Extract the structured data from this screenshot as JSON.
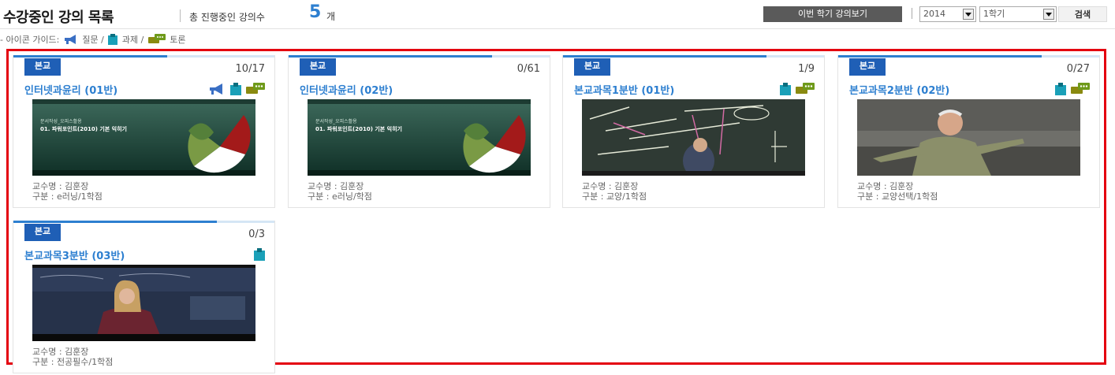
{
  "header": {
    "title": "수강중인 강의 목록",
    "subtitle": "총 진행중인 강의수",
    "count": "5",
    "count_unit": "개",
    "semester_button": "이번 학기 강의보기",
    "year_select": "2014",
    "term_select": "1학기",
    "search_button": "검색"
  },
  "guide": {
    "prefix": "- 아이콘 가이드:",
    "question": "질문 /",
    "assignment": "과제 /",
    "discussion": "토론"
  },
  "colors": {
    "accent": "#2d7fd0",
    "badge": "#1f5fb6",
    "highlight_border": "#e4000f",
    "icon_question": "#3a6fc4",
    "icon_assignment": "#1aa0b8",
    "icon_discussion": "#8a8a10"
  },
  "courses": [
    {
      "badge": "본교",
      "progress_text": "10/17",
      "progress": 0.59,
      "title": "인터넷과윤리 (01반)",
      "icons": [
        "megaphone-icon",
        "clipboard-icon",
        "chat-icon"
      ],
      "thumbnail": "slide-cover",
      "professor": "교수명 : 김훈장",
      "category": "구분 : e러닝/1학점"
    },
    {
      "badge": "본교",
      "progress_text": "0/61",
      "progress": 0.78,
      "title": "인터넷과윤리 (02반)",
      "icons": [],
      "thumbnail": "slide-cover",
      "professor": "교수명 : 김훈장",
      "category": "구분 : e러닝/학점"
    },
    {
      "badge": "본교",
      "progress_text": "1/9",
      "progress": 0.78,
      "title": "본교과목1분반 (01반)",
      "icons": [
        "clipboard-icon",
        "chat-icon"
      ],
      "thumbnail": "blackboard-lecture",
      "professor": "교수명 : 김훈장",
      "category": "구분 : 교양/1학점"
    },
    {
      "badge": "본교",
      "progress_text": "0/27",
      "progress": 0.78,
      "title": "본교과목2분반 (02반)",
      "icons": [
        "clipboard-icon",
        "chat-icon"
      ],
      "thumbnail": "professor-lecture",
      "professor": "교수명 : 김훈장",
      "category": "구분 : 교양선택/1학점"
    },
    {
      "badge": "본교",
      "progress_text": "0/3",
      "progress": 0.78,
      "title": "본교과목3분반 (03반)",
      "icons": [
        "clipboard-icon"
      ],
      "thumbnail": "speaker-lecture",
      "professor": "교수명 : 김훈장",
      "category": "구분 : 전공필수/1학점"
    }
  ],
  "slide_text": {
    "line1": "문서작성_오피스활용",
    "line2": "01. 파워포인트(2010) 기본 익히기"
  }
}
